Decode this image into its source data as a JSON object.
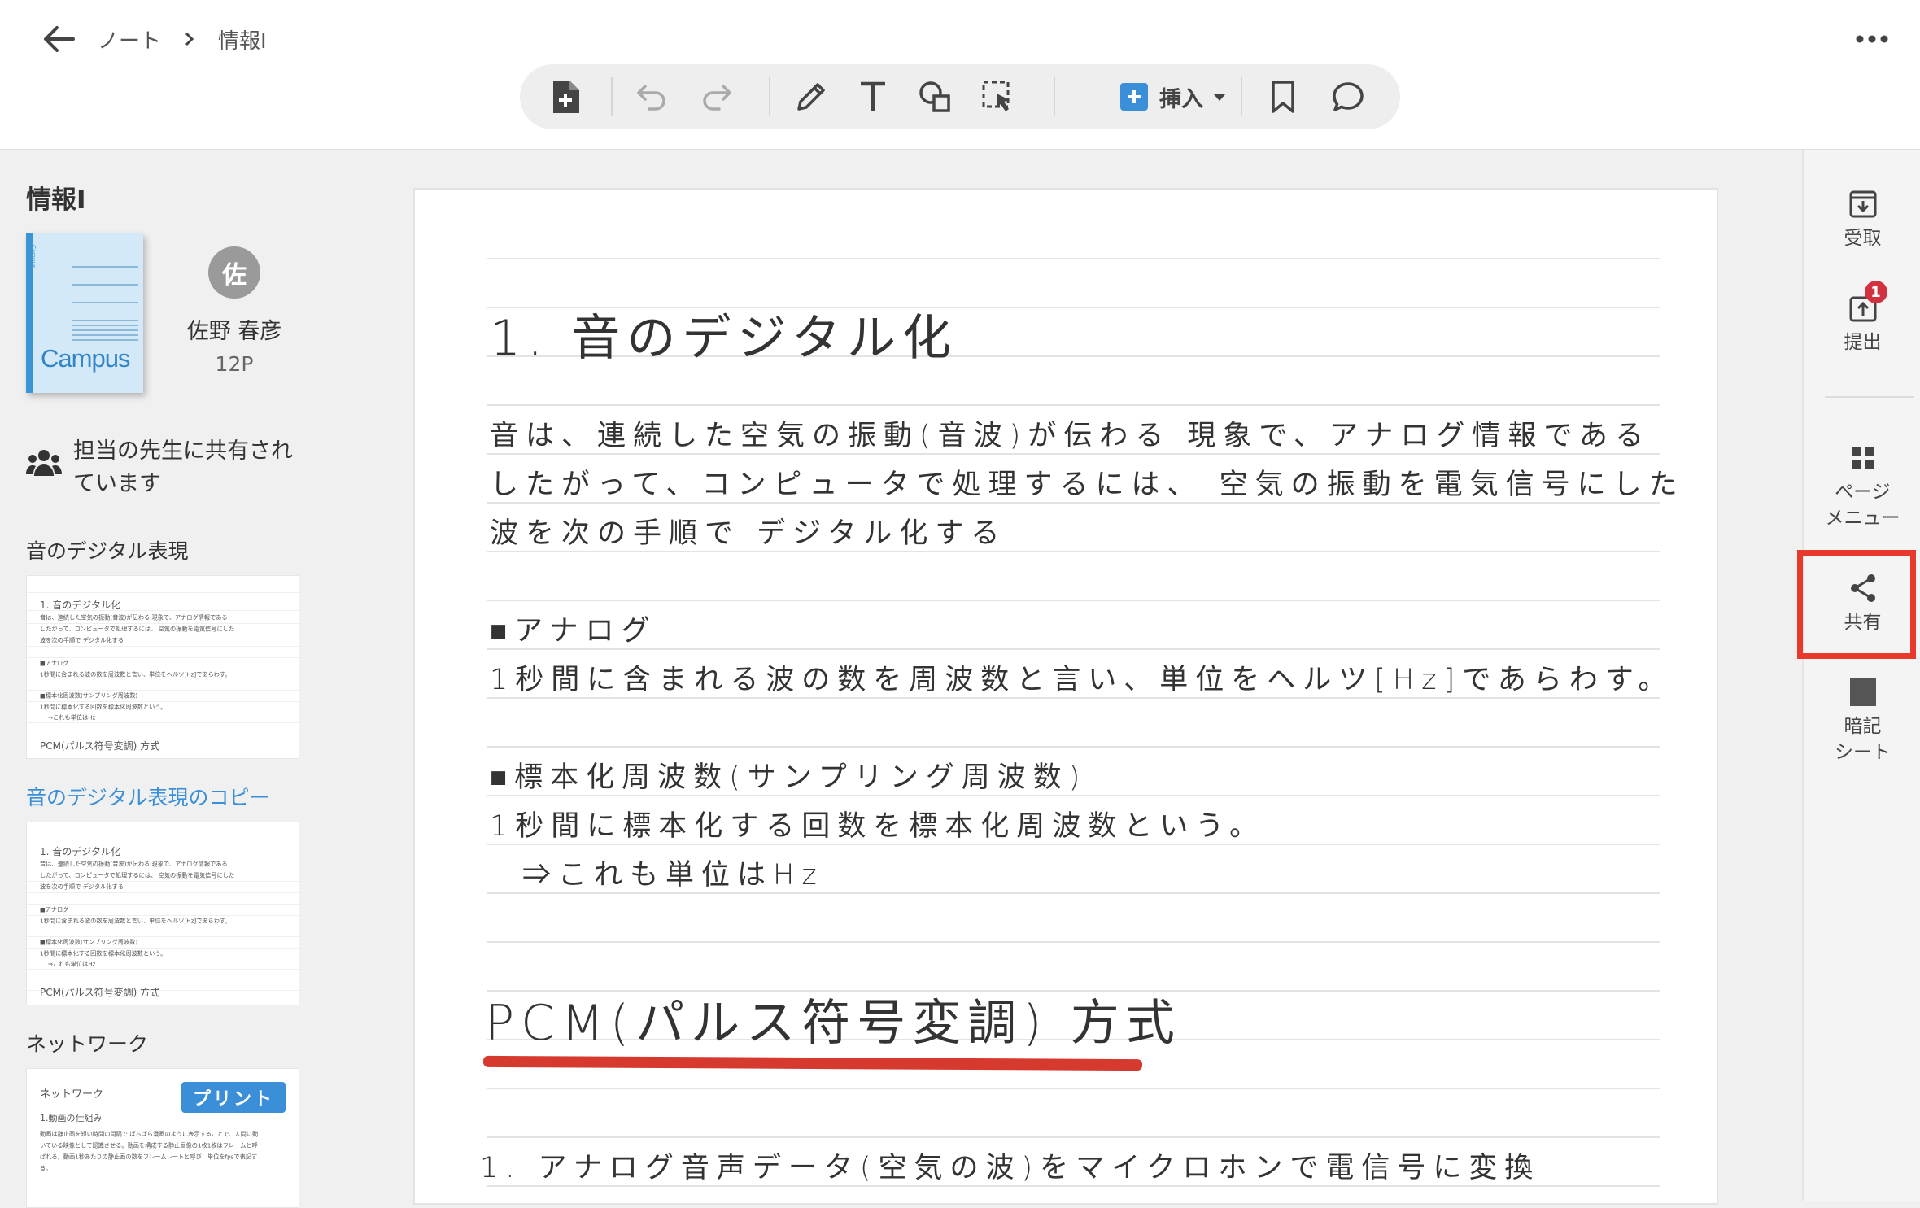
{
  "breadcrumb": {
    "parent": "ノート",
    "current": "情報I"
  },
  "toolbar": {
    "insert_label": "挿入"
  },
  "sidebar": {
    "notebook_title": "情報I",
    "cover_brand": "Campus",
    "cover_tiny": "Campus",
    "owner_initial": "佐",
    "owner_name": "佐野 春彦",
    "page_count": "12P",
    "share_info": "担当の先生に共有されています",
    "sections": [
      {
        "title": "音のデジタル表現",
        "thumb_lines": [
          "1. 音のデジタル化",
          "音は、連続した空気の振動(音波)が伝わる 現象で、アナログ情報である",
          "したがって、コンピュータで処理するには、 空気の振動を電気信号にした",
          "波を次の手順で デジタル化する",
          "■アナログ",
          "1秒間に含まれる波の数を周波数と言い、単位をヘルツ[Hz]であらわす。",
          "■標本化周波数(サンプリング周波数)",
          "1秒間に標本化する回数を標本化周波数という。",
          "⇒これも単位はHz",
          "PCM(パルス符号変調) 方式"
        ]
      },
      {
        "title": "音のデジタル表現のコピー",
        "thumb_lines": [
          "1. 音のデジタル化",
          "音は、連続した空気の振動(音波)が伝わる 現象で、アナログ情報である",
          "したがって、コンピュータで処理するには、 空気の振動を電気信号にした",
          "波を次の手順で デジタル化する",
          "■アナログ",
          "1秒間に含まれる波の数を周波数と言い、単位をヘルツ[Hz]であらわす。",
          "■標本化周波数(サンプリング周波数)",
          "1秒間に標本化する回数を標本化周波数という。",
          "⇒これも単位はHz",
          "PCM(パルス符号変調) 方式"
        ]
      },
      {
        "title": "ネットワーク",
        "print_label": "プリント",
        "thumb_lines": [
          "ネットワーク",
          "1.動画の仕組み",
          "動画は静止画を短い時間の間隔で ぱらぱら漫画のように表示することで、人間に動",
          "いている映像として認識させる。動画を構成する静止画像の1枚1枚はフレームと呼",
          "ばれる。動画1秒あたりの静止画の数をフレームレートと呼び、単位をfpsで表記す",
          "る。"
        ]
      }
    ]
  },
  "note": {
    "lines": [
      "1. 音のデジタル化",
      "音は、連続した空気の振動(音波)が伝わる 現象で、アナログ情報である",
      "したがって、コンピュータで処理するには、 空気の振動を電気信号にした",
      "波を次の手順で デジタル化する",
      "■アナログ",
      "1秒間に含まれる波の数を周波数と言い、単位をヘルツ[Hz]であらわす。",
      "■標本化周波数(サンプリング周波数)",
      "1秒間に標本化する回数を標本化周波数という。",
      "⇒これも単位はHz",
      "PCM(パルス符号変調) 方式",
      "1. アナログ音声データ(空気の波)をマイクロホンで電信号に変換"
    ],
    "underline_color": "#d63a2f"
  },
  "rail": {
    "receive": "受取",
    "submit": "提出",
    "submit_badge": "1",
    "page_menu_1": "ページ",
    "page_menu_2": "メニュー",
    "share": "共有",
    "memorize_1": "暗記",
    "memorize_2": "シート"
  },
  "colors": {
    "accent": "#3a8fd8",
    "highlight": "#e8392c",
    "badge": "#d23240"
  }
}
